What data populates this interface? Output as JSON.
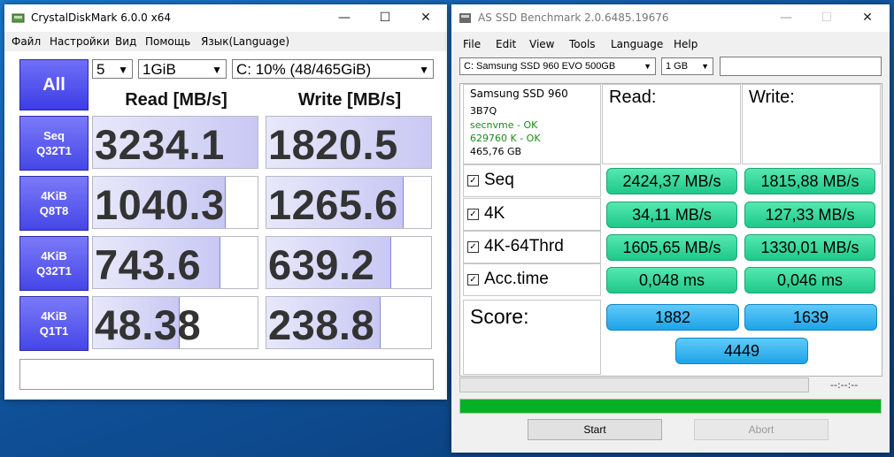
{
  "cdm": {
    "title": "CrystalDiskMark 6.0.0 x64",
    "menu": [
      "Файл",
      "Настройки",
      "Вид",
      "Помощь",
      "Язык(Language)"
    ],
    "all_label": "All",
    "count": "5",
    "size": "1GiB",
    "drive": "C: 10% (48/465GiB)",
    "read_head": "Read [MB/s]",
    "write_head": "Write [MB/s]",
    "rows": [
      {
        "l1": "Seq",
        "l2": "Q32T1",
        "read": "3234.1",
        "write": "1820.5",
        "rf": 1.0,
        "wf": 0.995
      },
      {
        "l1": "4KiB",
        "l2": "Q8T8",
        "read": "1040.3",
        "write": "1265.6",
        "rf": 0.8,
        "wf": 0.83
      },
      {
        "l1": "4KiB",
        "l2": "Q32T1",
        "read": "743.6",
        "write": "639.2",
        "rf": 0.77,
        "wf": 0.75
      },
      {
        "l1": "4KiB",
        "l2": "Q1T1",
        "read": "48.38",
        "write": "238.8",
        "rf": 0.52,
        "wf": 0.69
      }
    ],
    "comment": ""
  },
  "asssd": {
    "title": "AS SSD Benchmark 2.0.6485.19676",
    "menu": [
      "File",
      "Edit",
      "View",
      "Tools",
      "Language",
      "Help"
    ],
    "drive_select": "C: Samsung SSD 960 EVO 500GB",
    "size_select": "1 GB",
    "extra_field": "",
    "info": {
      "model": "Samsung SSD 960",
      "fw": "3B7Q",
      "driver": "secnvme - OK",
      "align": "629760 K - OK",
      "capacity": "465,76 GB"
    },
    "read_head": "Read:",
    "write_head": "Write:",
    "tests": [
      {
        "name": "Seq",
        "read": "2424,37 MB/s",
        "write": "1815,88 MB/s"
      },
      {
        "name": "4K",
        "read": "34,11 MB/s",
        "write": "127,33 MB/s"
      },
      {
        "name": "4K-64Thrd",
        "read": "1605,65 MB/s",
        "write": "1330,01 MB/s"
      },
      {
        "name": "Acc.time",
        "read": "0,048 ms",
        "write": "0,046 ms"
      }
    ],
    "score_label": "Score:",
    "score_read": "1882",
    "score_write": "1639",
    "score_total": "4449",
    "time": "--:--:--",
    "progress": 1.0,
    "start_label": "Start",
    "abort_label": "Abort"
  }
}
